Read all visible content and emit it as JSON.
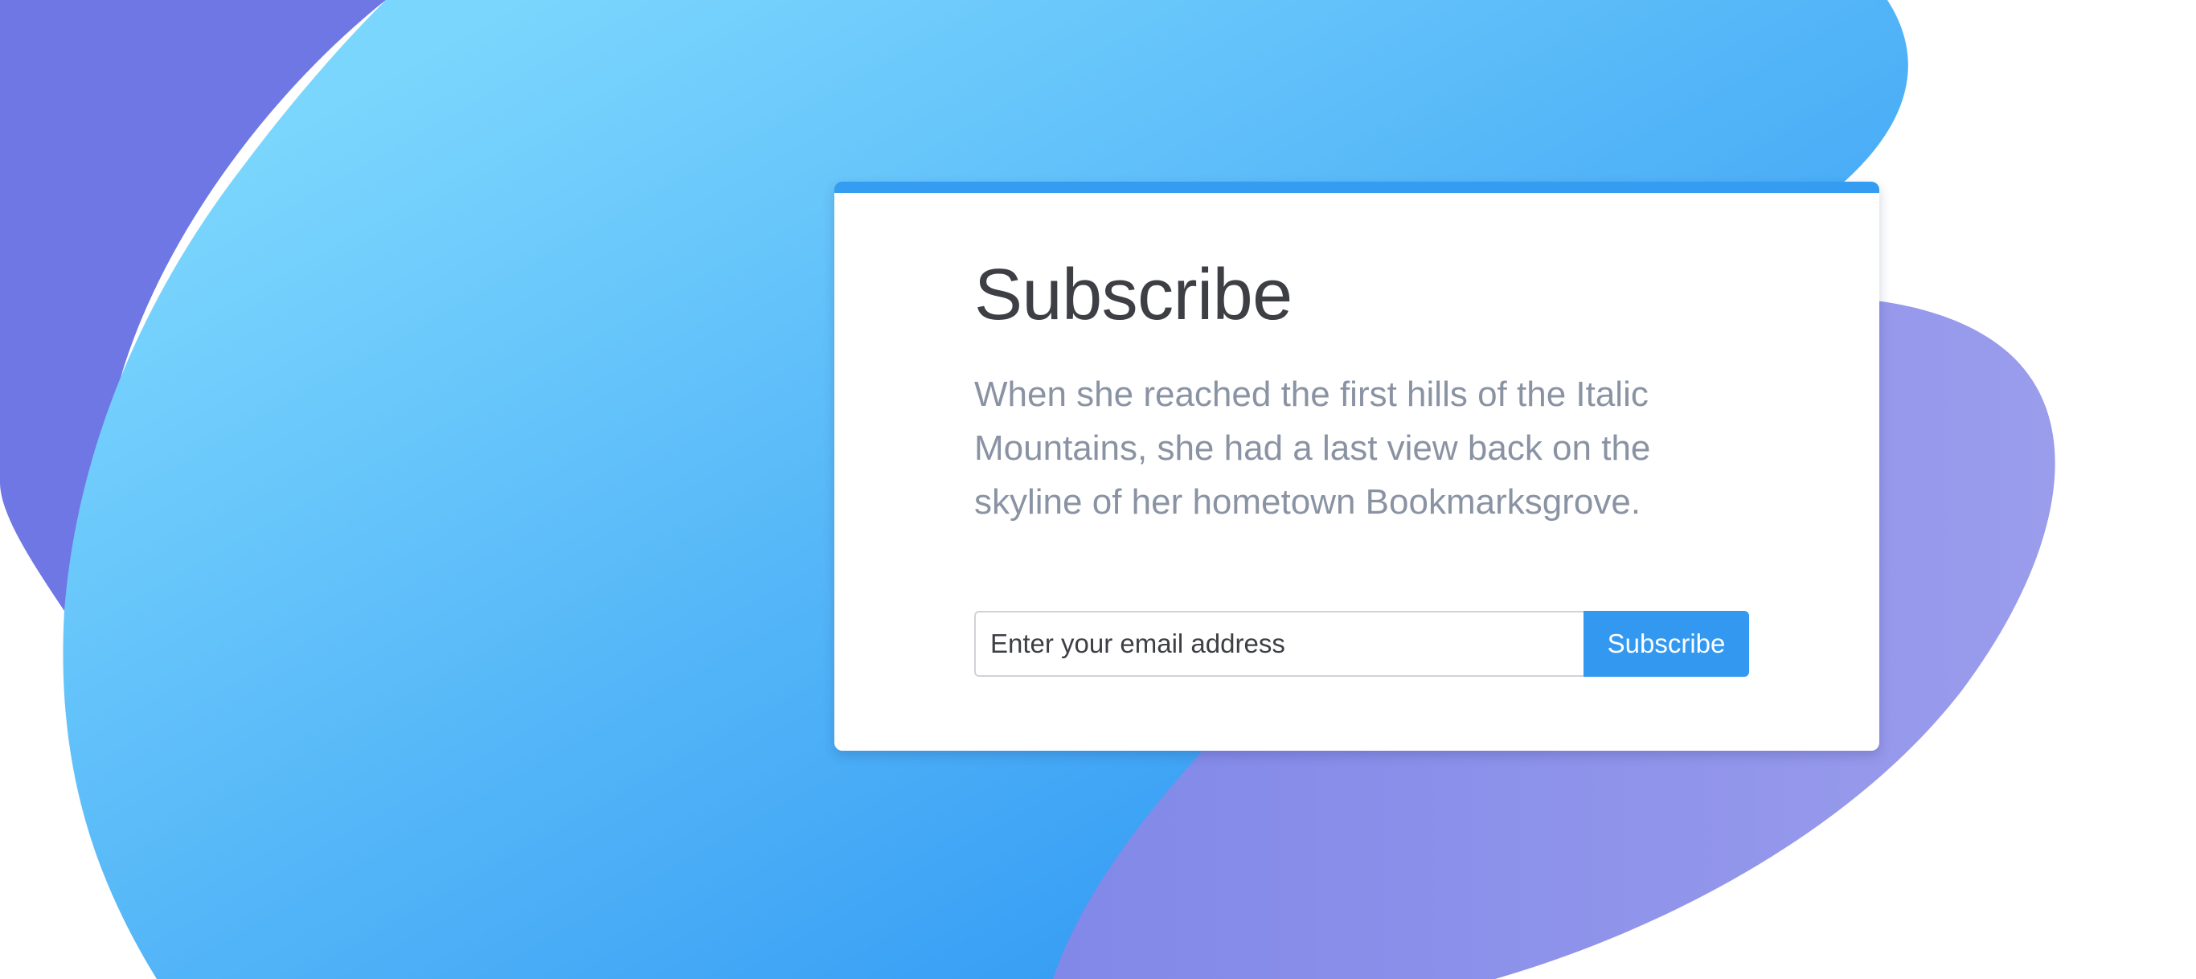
{
  "theme": {
    "accent": "#349df2",
    "button_color": "#3399f0",
    "blob_purple_dark": "#6f77e5",
    "blob_purple_light": "#9a9cec",
    "blob_blue_light": "#78d4fd",
    "blob_blue_dark": "#2f97f3",
    "title_color": "#3d3f44",
    "text_color": "#8a93a3"
  },
  "card": {
    "title": "Subscribe",
    "description": "When she reached the first hills of the Italic Mountains, she had a last view back on the skyline of her hometown Bookmarksgrove.",
    "email_placeholder": "Enter your email address",
    "button_label": "Subscribe"
  }
}
